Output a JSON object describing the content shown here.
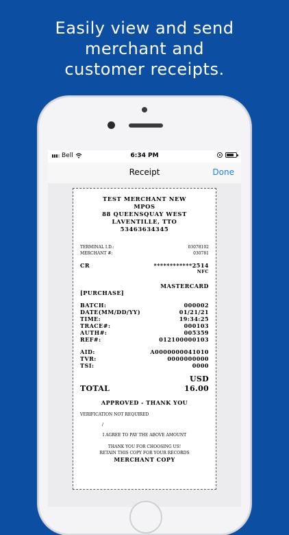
{
  "headline": {
    "line1": "Easily view and send",
    "line2": "merchant and",
    "line3": "customer receipts."
  },
  "statusbar": {
    "carrier": "Bell",
    "time": "6:34 PM"
  },
  "navbar": {
    "title": "Receipt",
    "done_label": "Done"
  },
  "receipt": {
    "merchant_lines": [
      "TEST MERCHANT NEW",
      "MPOS",
      "88 QUEENSQUAY WEST",
      "LAVENTILLE, TTO",
      "53463634345"
    ],
    "terminal_label": "TERMINAL I.D.:",
    "terminal_value": "03078102",
    "merchant_label": "MERCHANT #:",
    "merchant_value": "030781",
    "card_type": "CR",
    "card_number": "************2514",
    "entry_mode": "NFC",
    "card_brand": "MASTERCARD",
    "transaction_type": "[PURCHASE]",
    "details": [
      {
        "label": "BATCH:",
        "value": "000002"
      },
      {
        "label": "DATE(MM/DD/YY)",
        "value": "01/21/21"
      },
      {
        "label": "TIME:",
        "value": "19:34:25"
      },
      {
        "label": "TRACE#:",
        "value": "000103"
      },
      {
        "label": "AUTH#:",
        "value": "005359"
      },
      {
        "label": "REF#:",
        "value": "012100000103"
      }
    ],
    "emv": [
      {
        "label": "AID:",
        "value": "A0000000041010"
      },
      {
        "label": "TVR:",
        "value": "0000000000"
      },
      {
        "label": "TSI:",
        "value": "0000"
      }
    ],
    "currency": "USD",
    "total_label": "TOTAL",
    "total_value": "16.00",
    "approval": "APPROVED - THANK YOU",
    "verification": "VERIFICATION NOT REQUIRED",
    "signature_mark": "/",
    "agree": "I AGREE TO PAY THE ABOVE AMOUNT",
    "thanks": "THANK YOU FOR CHOOSING US!",
    "retain": "RETAIN THIS COPY FOR YOUR RECORDS",
    "copy_label": "MERCHANT COPY"
  },
  "colors": {
    "background": "#0b4ea2",
    "link": "#1a7cf5"
  },
  "battery_level": 0.8
}
